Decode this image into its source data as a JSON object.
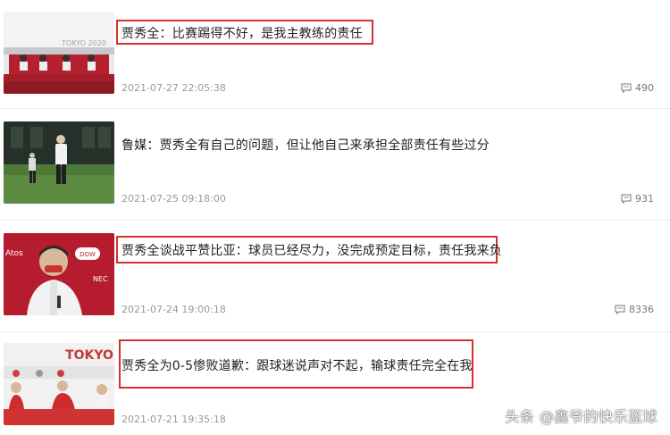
{
  "articles": [
    {
      "title": "贾秀全：比赛踢得不好，是我主教练的责任",
      "date": "2021-07-27 22:05:38",
      "comments": "490",
      "thumb_text": "TOKYO 2020"
    },
    {
      "title": "鲁媒：贾秀全有自己的问题，但让他自己来承担全部责任有些过分",
      "date": "2021-07-25 09:18:00",
      "comments": "931"
    },
    {
      "title": "贾秀全谈战平赞比亚：球员已经尽力，没完成预定目标，责任我来负",
      "date": "2021-07-24 19:00:18",
      "comments": "8336",
      "thumb_logos": [
        "Atos",
        "DOW",
        "NEC"
      ]
    },
    {
      "title": "贾秀全为0-5惨败道歉：跟球迷说声对不起，输球责任完全在我",
      "date": "2021-07-21 19:35:18",
      "comments": "",
      "thumb_text": "TOKYO"
    }
  ],
  "watermark": "头条 @鑫爷的快乐蓝球",
  "colors": {
    "highlight": "#d6302b",
    "meta": "#999999"
  },
  "icons": {
    "comment": "comment-bubble-icon"
  }
}
